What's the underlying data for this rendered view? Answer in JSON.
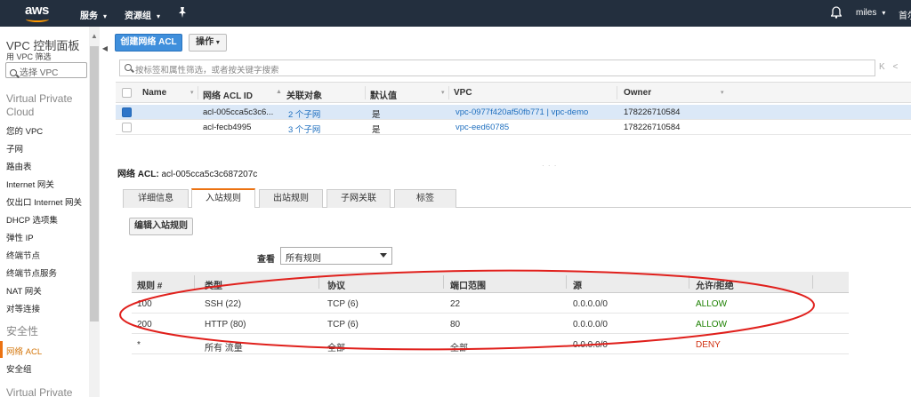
{
  "topnav": {
    "logo_text": "aws",
    "services_label": "服务",
    "resource_groups_label": "资源组",
    "pin_icon": "pin-icon",
    "bell_icon": "bell-icon",
    "user_label": "miles",
    "region_label": "首尔"
  },
  "sidebar": {
    "title": "VPC 控制面板",
    "filter_label": "用 VPC 筛选",
    "select_placeholder": "选择 VPC",
    "section_vpc": "Virtual Private Cloud",
    "items": [
      "您的 VPC",
      "子网",
      "路由表",
      "Internet 网关",
      "仅出口 Internet 网关",
      "DHCP 选项集",
      "弹性 IP",
      "终端节点",
      "终端节点服务",
      "NAT 网关",
      "对等连接"
    ],
    "section_security": "安全性",
    "security_items": [
      "网络 ACL",
      "安全组"
    ],
    "section_vpn": "Virtual Private",
    "active_color": "#ec7211"
  },
  "toolbar": {
    "create_label": "创建网络 ACL",
    "actions_label": "操作",
    "search_placeholder": "按标签和属性筛选，或者按关键字搜索",
    "pager": "K <"
  },
  "acl_table": {
    "headers": [
      "Name",
      "网络 ACL ID",
      "关联对象",
      "默认值",
      "VPC",
      "Owner"
    ],
    "rows": [
      {
        "name": "",
        "id": "acl-005cca5c3c6...",
        "assoc": "2 个子网",
        "default": "是",
        "vpc": "vpc-0977f420af50fb771 | vpc-demo",
        "owner": "178226710584",
        "selected": true
      },
      {
        "name": "",
        "id": "acl-fecb4995",
        "assoc": "3 个子网",
        "default": "是",
        "vpc": "vpc-eed60785",
        "owner": "178226710584",
        "selected": false
      }
    ]
  },
  "detail": {
    "acl_label": "网络 ACL:",
    "acl_id": "acl-005cca5c3c687207c",
    "tabs": [
      "详细信息",
      "入站规则",
      "出站规则",
      "子网关联",
      "标签"
    ],
    "active_tab": "入站规则",
    "edit_button": "编辑入站规则",
    "view_label": "查看",
    "view_value": "所有规则"
  },
  "rules": {
    "headers": [
      "规则 #",
      "类型",
      "协议",
      "端口范围",
      "源",
      "允许/拒绝"
    ],
    "rows": [
      {
        "rule": "100",
        "type": "SSH (22)",
        "protocol": "TCP (6)",
        "port": "22",
        "source": "0.0.0.0/0",
        "action": "ALLOW"
      },
      {
        "rule": "200",
        "type": "HTTP (80)",
        "protocol": "TCP (6)",
        "port": "80",
        "source": "0.0.0.0/0",
        "action": "ALLOW"
      },
      {
        "rule": "*",
        "type": "所有 流量",
        "protocol": "全部",
        "port": "全部",
        "source": "0.0.0.0/0",
        "action": "DENY"
      }
    ],
    "allow_color": "#1d8102",
    "deny_color": "#d13212"
  },
  "annotation": {
    "color": "#e0201c"
  }
}
